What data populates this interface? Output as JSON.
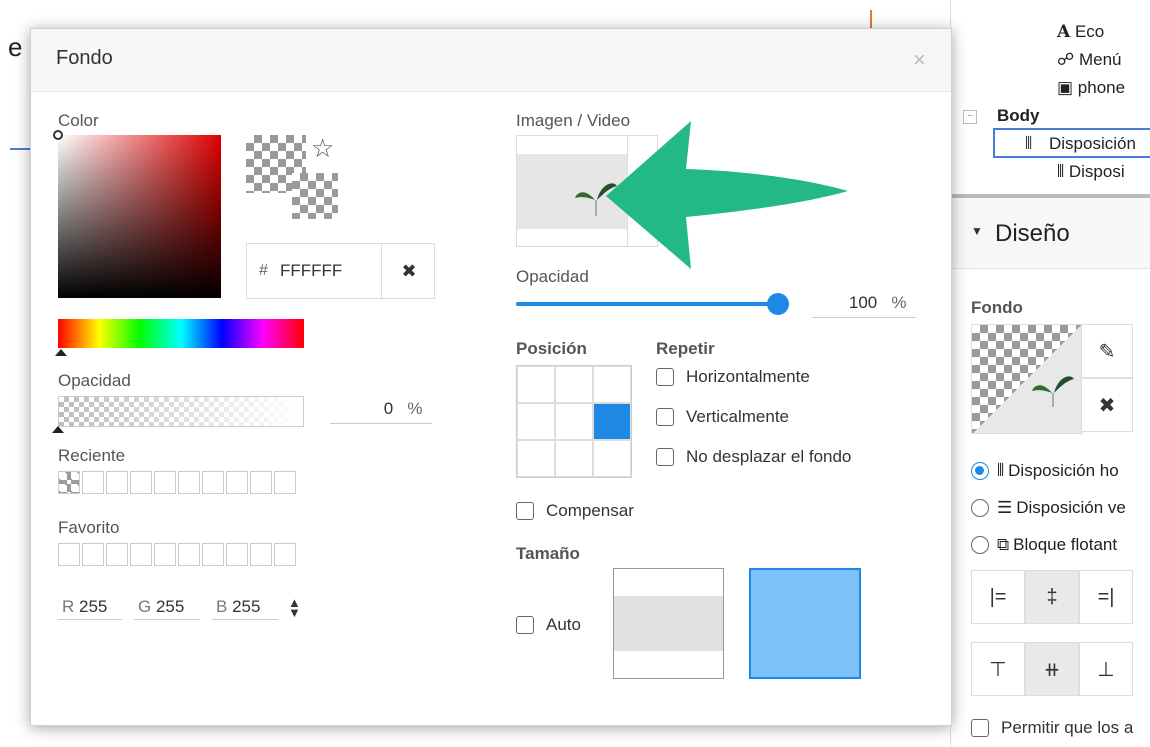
{
  "right_panel": {
    "tree": [
      {
        "icon": "text-icon",
        "glyph": "A",
        "label": "Eco"
      },
      {
        "icon": "sitemap-icon",
        "glyph": "☍",
        "label": "Menú"
      },
      {
        "icon": "image-icon",
        "glyph": "▣",
        "label": "phone"
      }
    ],
    "body_label": "Body",
    "selected_node": "Disposición",
    "child_node": "Disposi",
    "section_title": "Diseño",
    "fondo_label": "Fondo",
    "layout_options": [
      {
        "label": "Disposición ho",
        "checked": true,
        "icon": "columns-icon",
        "glyph": "⫴"
      },
      {
        "label": "Disposición ve",
        "checked": false,
        "icon": "rows-icon",
        "glyph": "☰"
      },
      {
        "label": "Bloque flotant",
        "checked": false,
        "icon": "float-block-icon",
        "glyph": "⧉"
      }
    ],
    "allow_label": "Permitir que los a"
  },
  "modal": {
    "title": "Fondo",
    "close_glyph": "×",
    "color": {
      "label": "Color",
      "hex_prefix": "#",
      "hex_value": "FFFFFF",
      "opacity_label": "Opacidad",
      "opacity_value": "0",
      "opacity_unit": "%",
      "opacity_level": 0,
      "recent_label": "Reciente",
      "favorite_label": "Favorito",
      "r_label": "R",
      "r_value": "255",
      "g_label": "G",
      "g_value": "255",
      "b_label": "B",
      "b_value": "255"
    },
    "image": {
      "label": "Imagen / Video",
      "opacity_label": "Opacidad",
      "opacity_value": "100",
      "opacity_unit": "%",
      "opacity_level": 1.0,
      "position_label": "Posición",
      "repeat_label": "Repetir",
      "repeat_options": [
        "Horizontalmente",
        "Verticalmente",
        "No desplazar el fondo"
      ],
      "compensate_label": "Compensar",
      "size_label": "Tamaño",
      "auto_label": "Auto"
    }
  },
  "colors": {
    "accent": "#1e88e5",
    "arrow": "#22b985",
    "size_selected": "#7cc1f8"
  }
}
